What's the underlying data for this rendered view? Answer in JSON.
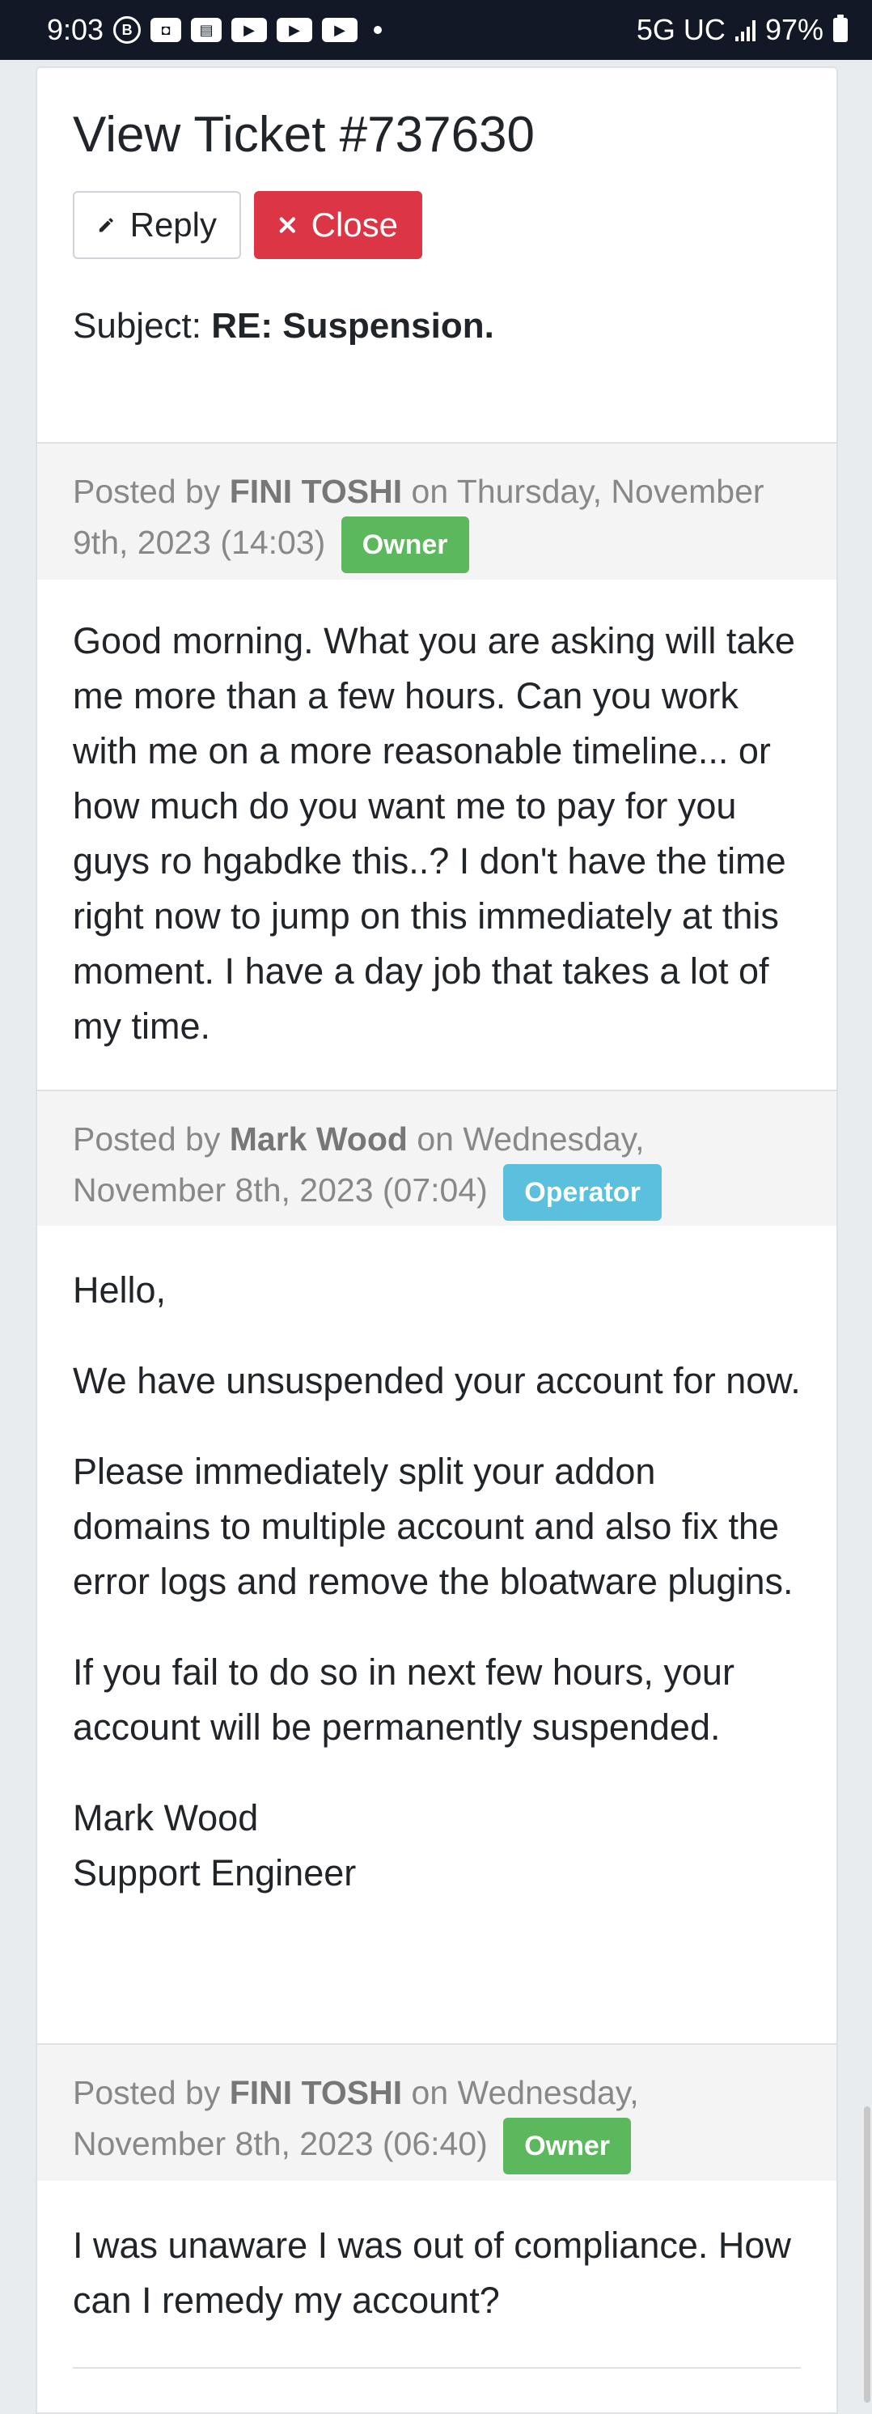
{
  "status_bar": {
    "time": "9:03",
    "network": "5G UC",
    "battery": "97%"
  },
  "ticket": {
    "title": "View Ticket #737630",
    "reply_label": "Reply",
    "close_label": "Close",
    "subject_label": "Subject:",
    "subject_value": "RE: Suspension."
  },
  "posts": [
    {
      "posted_by_prefix": "Posted by",
      "author": "FINI TOSHI",
      "date_text": "on Thursday, November 9th, 2023 (14:03)",
      "role": "Owner",
      "role_color": "#5cb85c",
      "body": [
        "Good morning. What you are asking will take me more than a few hours. Can you work with me on a more reasonable timeline... or how much do you want me to pay for you guys ro hgabdke this..? I don't have the time right now to jump on this immediately at this moment. I have a day job that takes a lot of my time."
      ]
    },
    {
      "posted_by_prefix": "Posted by",
      "author": "Mark Wood",
      "date_text": "on Wednesday, November 8th, 2023 (07:04)",
      "role": "Operator",
      "role_color": "#5bc0de",
      "body": [
        "Hello,",
        "We have unsuspended your account for now.",
        "Please immediately split your addon domains to multiple account and also fix the error logs and remove the bloatware plugins.",
        "If you fail to do so in next few hours, your account will be permanently suspended.",
        "Mark Wood",
        "Support Engineer"
      ]
    },
    {
      "posted_by_prefix": "Posted by",
      "author": "FINI TOSHI",
      "date_text": "on Wednesday, November 8th, 2023 (06:40)",
      "role": "Owner",
      "role_color": "#5cb85c",
      "body": [
        "I was unaware I was out of compliance. How can I remedy my account?"
      ]
    }
  ]
}
